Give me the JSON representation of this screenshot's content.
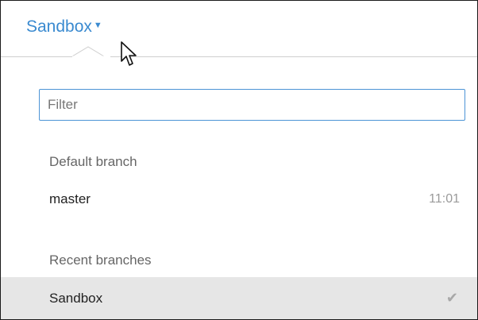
{
  "header": {
    "current_branch": "Sandbox",
    "caret_icon": "caret-down-icon"
  },
  "filter": {
    "value": "",
    "placeholder": "Filter"
  },
  "default_section": {
    "label": "Default branch",
    "branches": [
      {
        "name": "master",
        "time": "11:01"
      }
    ]
  },
  "recent_section": {
    "label": "Recent branches",
    "branches": [
      {
        "name": "Sandbox",
        "selected": true,
        "icon": "checkmark-icon"
      }
    ]
  },
  "colors": {
    "accent": "#3a8ad0",
    "selected_row": "#e6e6e6"
  }
}
